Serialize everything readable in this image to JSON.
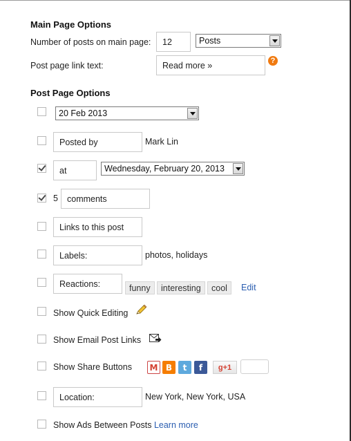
{
  "main_options": {
    "heading": "Main Page Options",
    "posts_count_label": "Number of posts on main page:",
    "posts_count_value": "12",
    "posts_unit": "Posts",
    "link_text_label": "Post page link text:",
    "link_text_value": "Read more »",
    "help_glyph": "?"
  },
  "post_options": {
    "heading": "Post Page Options",
    "date_header": {
      "checked": false,
      "value": "20 Feb 2013"
    },
    "posted_by": {
      "checked": false,
      "field": "Posted by",
      "value": "Mark Lin"
    },
    "timestamp": {
      "checked": true,
      "field": "at",
      "value": "Wednesday, February 20, 2013"
    },
    "comments": {
      "checked": true,
      "count": "5",
      "field": "comments"
    },
    "links": {
      "checked": false,
      "field": "Links to this post"
    },
    "labels": {
      "checked": false,
      "field": "Labels:",
      "value": "photos, holidays"
    },
    "reactions": {
      "checked": false,
      "field": "Reactions:",
      "chips": [
        "funny",
        "interesting",
        "cool"
      ],
      "edit_label": "Edit"
    },
    "quick_editing": {
      "checked": false,
      "label": "Show Quick Editing",
      "icon": "pencil-icon"
    },
    "email_links": {
      "checked": false,
      "label": "Show Email Post Links",
      "icon": "email-icon"
    },
    "share_buttons": {
      "checked": false,
      "label": "Show Share Buttons",
      "buttons": [
        {
          "name": "gmail",
          "glyph": "M",
          "color": "#d44132"
        },
        {
          "name": "blogger",
          "glyph": "B",
          "color": "#f57d00"
        },
        {
          "name": "twitter",
          "glyph": "t",
          "color": "#5ea9dd"
        },
        {
          "name": "facebook",
          "glyph": "f",
          "color": "#3b5998"
        }
      ],
      "gplus_label": "g+1"
    },
    "location": {
      "checked": false,
      "field": "Location:",
      "value": "New York, New York, USA"
    },
    "ads": {
      "checked": false,
      "label": "Show Ads Between Posts",
      "link_label": "Learn more"
    }
  }
}
